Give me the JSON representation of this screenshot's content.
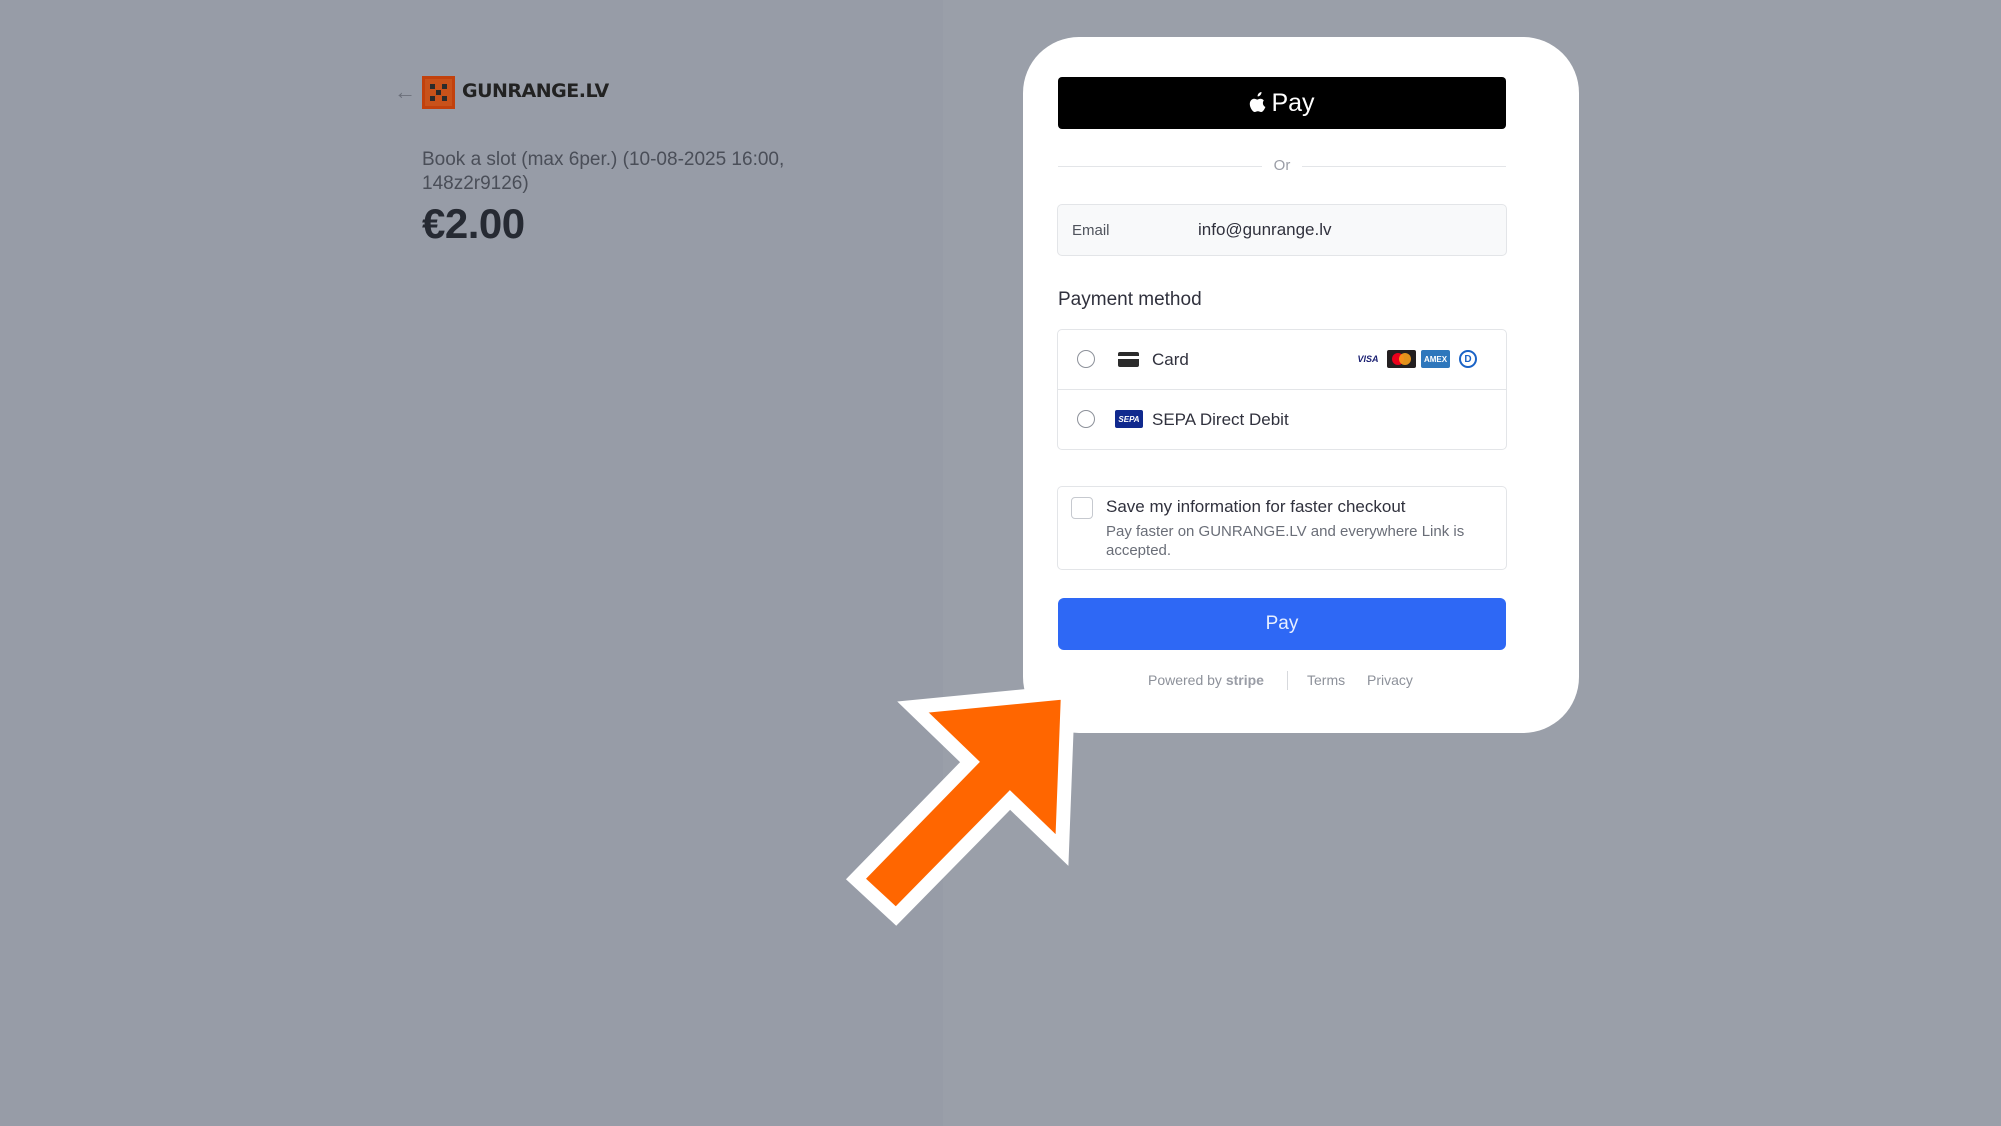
{
  "merchant": {
    "back_arrow": "←",
    "logo_text": "GUNRANGE.LV"
  },
  "order": {
    "product_name": "Book a slot (max 6per.) (10-08-2025 16:00, 148z2r9126)",
    "price": "€2.00"
  },
  "checkout": {
    "apple_pay_label": "Pay",
    "or_label": "Or",
    "email_label": "Email",
    "email_value": "info@gunrange.lv",
    "payment_method_title": "Payment method",
    "methods": [
      {
        "label": "Card",
        "icon": "credit-card-icon",
        "brands": [
          "VISA",
          "Mastercard",
          "AMEX",
          "Diners"
        ]
      },
      {
        "label": "SEPA Direct Debit",
        "icon": "sepa-icon"
      }
    ],
    "save_info": {
      "title": "Save my information for faster checkout",
      "subtitle": "Pay faster on GUNRANGE.LV and everywhere Link is accepted.",
      "checked": false
    },
    "pay_button": "Pay",
    "footer": {
      "powered_by": "Powered by",
      "stripe": "stripe",
      "terms": "Terms",
      "privacy": "Privacy"
    }
  },
  "colors": {
    "pay_button": "#2e68f5",
    "logo_accent": "#c9521a",
    "annotation_arrow": "#ff6600"
  },
  "annotation": {
    "icon": "orange-arrow-pointing-up-right"
  }
}
